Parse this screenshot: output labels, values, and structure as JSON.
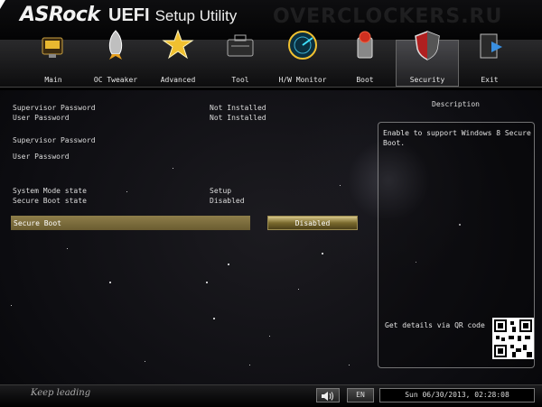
{
  "header": {
    "logo": "ASRock",
    "title_bold": "UEFI",
    "title_rest": "Setup Utility",
    "watermark": "OVERCLOCKERS.RU"
  },
  "tabs": [
    {
      "label": "Main",
      "icon": "main-icon"
    },
    {
      "label": "OC Tweaker",
      "icon": "rocket-icon"
    },
    {
      "label": "Advanced",
      "icon": "star-icon"
    },
    {
      "label": "Tool",
      "icon": "toolbox-icon"
    },
    {
      "label": "H/W Monitor",
      "icon": "radar-icon"
    },
    {
      "label": "Boot",
      "icon": "power-icon"
    },
    {
      "label": "Security",
      "icon": "shield-icon",
      "active": true
    },
    {
      "label": "Exit",
      "icon": "exit-icon"
    }
  ],
  "settings": {
    "supervisor_password_status_label": "Supervisor Password",
    "supervisor_password_status_value": "Not Installed",
    "user_password_status_label": "User Password",
    "user_password_status_value": "Not Installed",
    "set_supervisor_password": "Supervisor Password",
    "set_user_password": "User Password",
    "system_mode_label": "System Mode state",
    "system_mode_value": "Setup",
    "secure_boot_state_label": "Secure Boot state",
    "secure_boot_state_value": "Disabled",
    "secure_boot_label": "Secure Boot",
    "secure_boot_value": "Disabled"
  },
  "description": {
    "title": "Description",
    "text": "Enable to support Windows 8 Secure Boot.",
    "qr_text": "Get details via QR code"
  },
  "footer": {
    "slogan": "Keep leading",
    "language": "EN",
    "clock": "Sun 06/30/2013, 02:28:08"
  },
  "colors": {
    "accent": "#8e7e4a",
    "background": "#0a0a0c"
  }
}
